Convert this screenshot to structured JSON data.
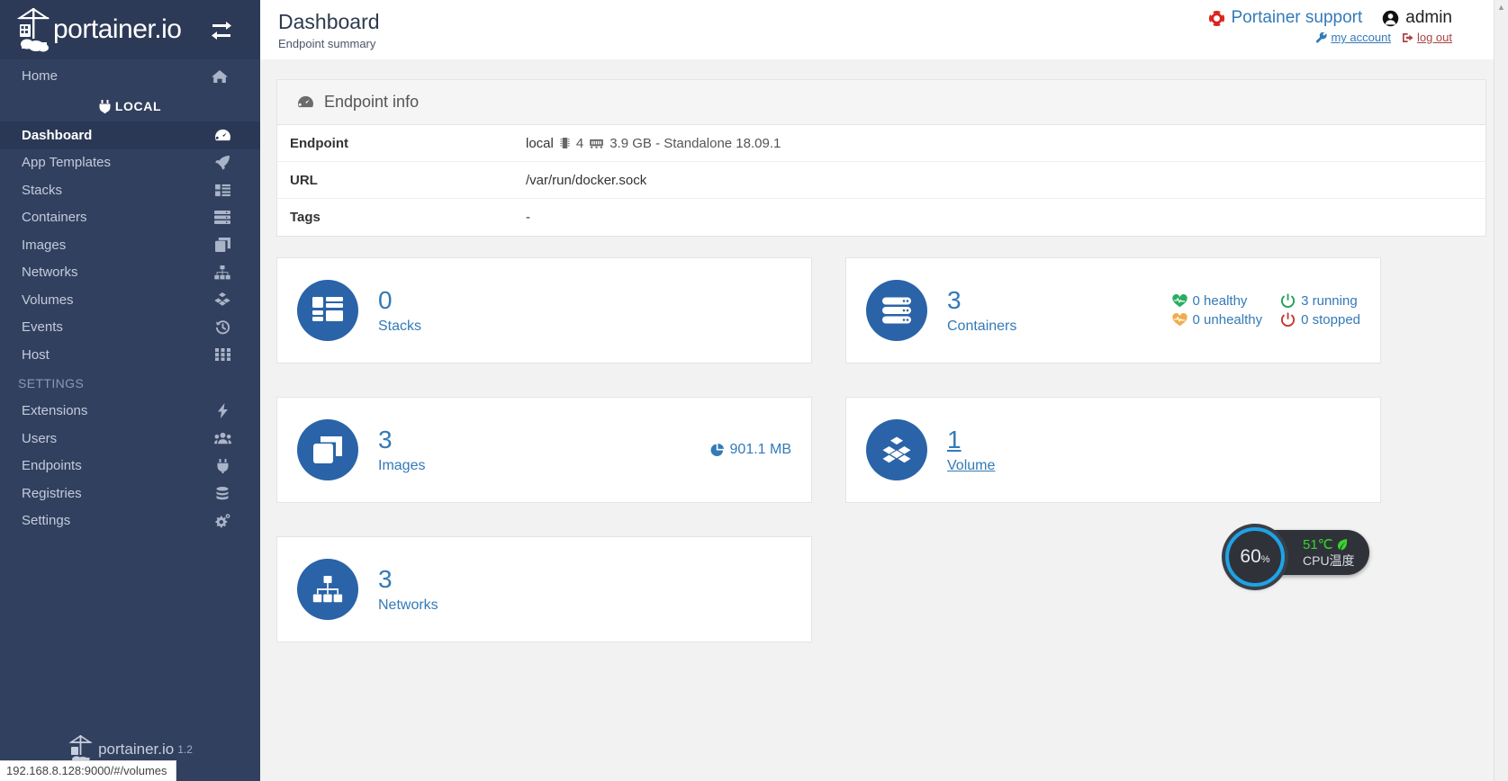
{
  "brand": {
    "name": "portainer.io",
    "logo_icon": "portainer-crane-logo",
    "toggle_icon": "sidebar-toggle-icon"
  },
  "sidebar": {
    "home": {
      "label": "Home",
      "icon": "home-icon"
    },
    "environment": {
      "label": "LOCAL",
      "icon": "plug-icon"
    },
    "items": [
      {
        "label": "Dashboard",
        "icon": "dashboard-icon",
        "active": true
      },
      {
        "label": "App Templates",
        "icon": "rocket-icon",
        "active": false
      },
      {
        "label": "Stacks",
        "icon": "stacks-icon",
        "active": false
      },
      {
        "label": "Containers",
        "icon": "containers-icon",
        "active": false
      },
      {
        "label": "Images",
        "icon": "images-icon",
        "active": false
      },
      {
        "label": "Networks",
        "icon": "networks-icon",
        "active": false
      },
      {
        "label": "Volumes",
        "icon": "volumes-icon",
        "active": false
      },
      {
        "label": "Events",
        "icon": "history-icon",
        "active": false
      },
      {
        "label": "Host",
        "icon": "host-grid-icon",
        "active": false
      }
    ],
    "section_label": "SETTINGS",
    "settings_items": [
      {
        "label": "Extensions",
        "icon": "bolt-icon"
      },
      {
        "label": "Users",
        "icon": "users-icon"
      },
      {
        "label": "Endpoints",
        "icon": "plug-icon"
      },
      {
        "label": "Registries",
        "icon": "database-icon"
      },
      {
        "label": "Settings",
        "icon": "gears-icon"
      }
    ],
    "footer": {
      "text": "portainer.io",
      "version": "1.2"
    }
  },
  "header": {
    "title": "Dashboard",
    "subtitle": "Endpoint summary",
    "support_label": "Portainer support",
    "support_icon": "lifebuoy-icon",
    "user_name": "admin",
    "user_icon": "user-circle-icon",
    "my_account_label": "my account",
    "my_account_icon": "wrench-icon",
    "logout_label": "log out",
    "logout_icon": "logout-icon"
  },
  "endpoint_panel": {
    "title": "Endpoint info",
    "title_icon": "tachometer-icon",
    "rows": [
      {
        "key": "Endpoint",
        "value": "local",
        "cpu_icon": "cpu-icon",
        "cpu_count": "4",
        "memory_icon": "memory-icon",
        "details": "3.9 GB - Standalone 18.09.1"
      },
      {
        "key": "URL",
        "value": "/var/run/docker.sock"
      },
      {
        "key": "Tags",
        "value": "-"
      }
    ]
  },
  "cards": [
    {
      "count": "0",
      "label": "Stacks",
      "icon": "stacks-icon",
      "linked": false,
      "extra": null,
      "stats": null
    },
    {
      "count": "3",
      "label": "Containers",
      "icon": "containers-icon",
      "linked": false,
      "extra": null,
      "stats": [
        {
          "text": "0 healthy",
          "icon": "heartbeat-icon",
          "color": "#27ae60"
        },
        {
          "text": "3 running",
          "icon": "power-icon",
          "color": "#21a05a"
        },
        {
          "text": "0 unhealthy",
          "icon": "heartbeat-icon",
          "color": "#f0ad4e"
        },
        {
          "text": "0 stopped",
          "icon": "power-icon",
          "color": "#c0392b"
        }
      ]
    },
    {
      "count": "3",
      "label": "Images",
      "icon": "images-icon",
      "linked": false,
      "extra": {
        "text": "901.1 MB",
        "icon": "pie-chart-icon"
      },
      "stats": null
    },
    {
      "count": "1",
      "label": "Volume",
      "icon": "volumes-icon",
      "linked": true,
      "extra": null,
      "stats": null
    },
    {
      "count": "3",
      "label": "Networks",
      "icon": "networks-icon",
      "linked": false,
      "extra": null,
      "stats": null
    }
  ],
  "cpu_widget": {
    "percent": "60",
    "percent_unit": "%",
    "temperature": "51℃",
    "temp_icon": "leaf-icon",
    "caption": "CPU温度",
    "ring_color": "#1ea3e8",
    "temp_color": "#38d430"
  },
  "statusbar": {
    "url": "192.168.8.128:9000/#/volumes"
  },
  "colors": {
    "sidebar_bg": "#32405f",
    "accent_blue": "#337ab7",
    "card_icon_bg": "#2a63a8",
    "page_bg": "#f2f2f2"
  }
}
